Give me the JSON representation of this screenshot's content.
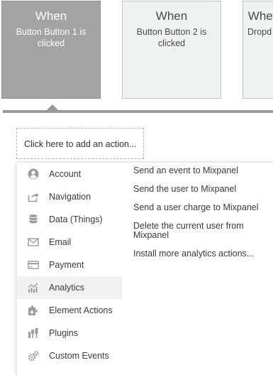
{
  "events": [
    {
      "title": "When",
      "description": "Button Button 1 is clicked"
    },
    {
      "title": "When",
      "description": "Button Button 2 is clicked"
    },
    {
      "title": "When",
      "description": "Dropd"
    }
  ],
  "action_panel": {
    "add_action_label": "Click here to add an action..."
  },
  "menu": {
    "categories": [
      {
        "label": "Account",
        "icon": "account-icon"
      },
      {
        "label": "Navigation",
        "icon": "navigation-icon"
      },
      {
        "label": "Data (Things)",
        "icon": "database-icon"
      },
      {
        "label": "Email",
        "icon": "email-icon"
      },
      {
        "label": "Payment",
        "icon": "credit-card-icon"
      },
      {
        "label": "Analytics",
        "icon": "analytics-icon",
        "selected": true
      },
      {
        "label": "Element Actions",
        "icon": "element-actions-icon"
      },
      {
        "label": "Plugins",
        "icon": "plugins-icon"
      },
      {
        "label": "Custom Events",
        "icon": "gears-icon"
      }
    ],
    "actions": [
      "Send an event to Mixpanel",
      "Send the user to Mixpanel",
      "Send a user charge to Mixpanel",
      "Delete the current user from Mixpanel",
      "Install more analytics actions..."
    ]
  },
  "colors": {
    "active_card": "#a3a3a3",
    "inactive_card": "#eef2f1",
    "icon_gray": "#9b9b9b",
    "selected_row": "#f1f1f1"
  }
}
